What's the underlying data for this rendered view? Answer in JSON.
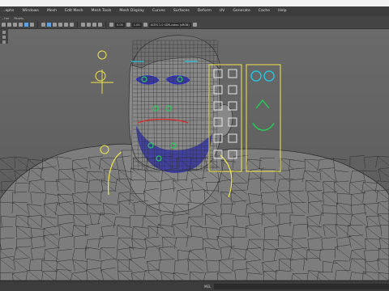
{
  "menubar": {
    "items": [
      "...aphs",
      "Windows",
      "Mesh",
      "Edit Mesh",
      "Mesh Tools",
      "Mesh Display",
      "Curves",
      "Surfaces",
      "Deform",
      "UV",
      "Generate",
      "Cache",
      "Help"
    ]
  },
  "panel_menu": {
    "items": [
      "...her",
      "Panels"
    ]
  },
  "toolbar": {
    "value_a": "0.00",
    "value_b": "1.00",
    "camera": "ACES 1.0 SDR-video (sRGB)"
  },
  "statusbar": {
    "label": "MEL"
  },
  "colors": {
    "wire_gray": "#2f2f2f",
    "wire_blue": "#1c1cff",
    "control_yellow": "#f2e64a",
    "joint_green": "#22cc55",
    "joint_red": "#e02626",
    "joint_cyan": "#22c6e0"
  }
}
